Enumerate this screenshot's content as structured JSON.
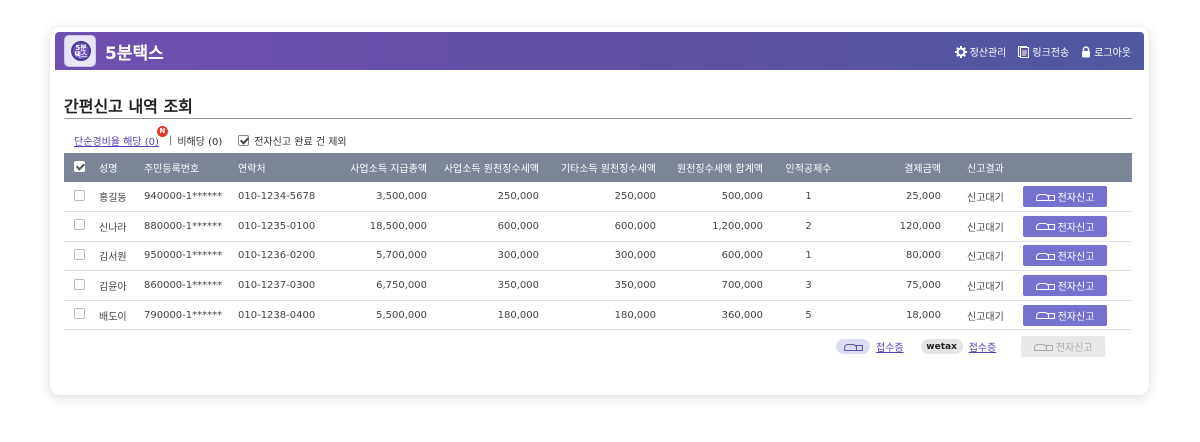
{
  "header": {
    "brand": "5분택스",
    "logo_text": "5분\n택스",
    "menu": [
      {
        "label": "정산관리",
        "icon": "gear-icon"
      },
      {
        "label": "링크전송",
        "icon": "document-icon"
      },
      {
        "label": "로그아웃",
        "icon": "lock-icon"
      }
    ]
  },
  "page": {
    "title": "간편신고 내역 조회"
  },
  "filters": {
    "simple_expense": "단순경비율 해당 (0)",
    "badge": "N",
    "separator": "|",
    "not_applicable": "비해당 (0)",
    "exclude_filed": "전자신고 완료 건 제외",
    "exclude_filed_checked": true
  },
  "table": {
    "columns": [
      "성명",
      "주민등록번호",
      "연락처",
      "사업소득 지급총액",
      "사업소득 원천징수세액",
      "기타소득 원천징수세액",
      "원천징수세액 합계액",
      "인적공제수",
      "결제금액",
      "신고결과"
    ],
    "action_label": "전자신고",
    "rows": [
      {
        "name": "홍길동",
        "rrn": "940000-1******",
        "phone": "010-1234-5678",
        "biz_total": "3,500,000",
        "biz_tax": "250,000",
        "other_tax": "250,000",
        "tax_sum": "500,000",
        "deductions": "1",
        "payment": "25,000",
        "result": "신고대기"
      },
      {
        "name": "신나라",
        "rrn": "880000-1******",
        "phone": "010-1235-0100",
        "biz_total": "18,500,000",
        "biz_tax": "600,000",
        "other_tax": "600,000",
        "tax_sum": "1,200,000",
        "deductions": "2",
        "payment": "120,000",
        "result": "신고대기"
      },
      {
        "name": "김서원",
        "rrn": "950000-1******",
        "phone": "010-1236-0200",
        "biz_total": "5,700,000",
        "biz_tax": "300,000",
        "other_tax": "300,000",
        "tax_sum": "600,000",
        "deductions": "1",
        "payment": "80,000",
        "result": "신고대기"
      },
      {
        "name": "김윤아",
        "rrn": "860000-1******",
        "phone": "010-1237-0300",
        "biz_total": "6,750,000",
        "biz_tax": "350,000",
        "other_tax": "350,000",
        "tax_sum": "700,000",
        "deductions": "3",
        "payment": "75,000",
        "result": "신고대기"
      },
      {
        "name": "배도이",
        "rrn": "790000-1******",
        "phone": "010-1238-0400",
        "biz_total": "5,500,000",
        "biz_tax": "180,000",
        "other_tax": "180,000",
        "tax_sum": "360,000",
        "deductions": "5",
        "payment": "18,000",
        "result": "신고대기"
      }
    ]
  },
  "footer": {
    "receipt_label": "접수증",
    "wetax_label": "wetax",
    "wetax_receipt_label": "접수증",
    "bulk_efile_label": "전자신고"
  },
  "colors": {
    "header_start": "#6f4fb1",
    "header_end": "#4f58a0",
    "table_header": "#7b8596",
    "efile_button": "#7670cf",
    "badge": "#e03a2a"
  }
}
